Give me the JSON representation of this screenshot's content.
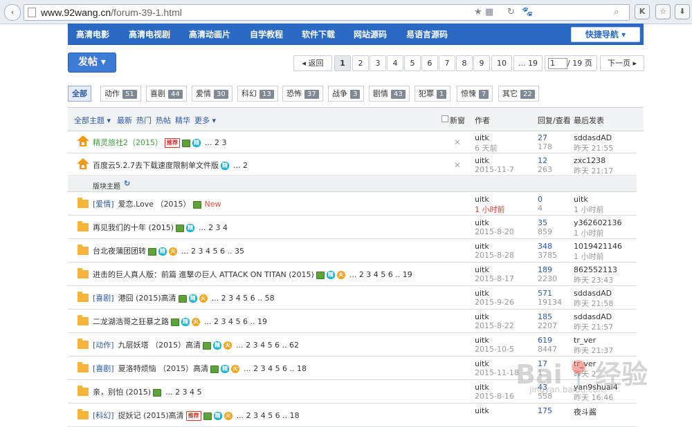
{
  "browser": {
    "url_host": "www.92wang.cn",
    "url_path": "/forum-39-1.html",
    "back_glyph": "‹"
  },
  "nav": {
    "items": [
      "高清电影",
      "高清电视剧",
      "高清动画片",
      "自学教程",
      "软件下载",
      "网站源码",
      "易语言源码"
    ],
    "quick_nav": "快捷导航 ▾"
  },
  "post_button": "发帖 ▾",
  "pager": {
    "back": "◂ 返回",
    "pages": [
      "1",
      "2",
      "3",
      "4",
      "5",
      "6",
      "7",
      "8",
      "9",
      "10",
      "... 19"
    ],
    "current": "1",
    "input_value": "1",
    "total": "/ 19 页",
    "next": "下一页 ▸"
  },
  "categories": [
    {
      "label": "全部",
      "count": ""
    },
    {
      "label": "动作",
      "count": "51"
    },
    {
      "label": "喜剧",
      "count": "44"
    },
    {
      "label": "爱情",
      "count": "30"
    },
    {
      "label": "科幻",
      "count": "13"
    },
    {
      "label": "恐怖",
      "count": "37"
    },
    {
      "label": "战争",
      "count": "3"
    },
    {
      "label": "剧情",
      "count": "43"
    },
    {
      "label": "犯罪",
      "count": "1"
    },
    {
      "label": "惊悚",
      "count": "7"
    },
    {
      "label": "其它",
      "count": "22"
    }
  ],
  "table_header": {
    "all_topics": "全部主题 ▾",
    "latest": "最新",
    "hot": "热门",
    "hot_posts": "热帖",
    "digest": "精华",
    "more": "更多 ▾",
    "new_window": "新窗",
    "author": "作者",
    "replies_views": "回复/查看",
    "last_post": "最后发表"
  },
  "section_label": "版块主题",
  "section_refresh": "↻",
  "badges": {
    "recommend": "推荐",
    "digest": "精",
    "hot": "火",
    "new": "New"
  },
  "sticky": [
    {
      "title": "精灵旅社2（2015）",
      "green": true,
      "badges": [
        "recommend",
        "img",
        "digest"
      ],
      "pages": "... 2 3",
      "author": "uitk",
      "date": "6 天前",
      "replies": "27",
      "views": "178",
      "last_user": "sddasdAD",
      "last_time": "昨天 21:55"
    },
    {
      "title": "百度云5.2.7去下载速度限制单文件版",
      "green": false,
      "badges": [
        "digest"
      ],
      "pages": "... 2",
      "author": "uitk",
      "date": "2015-11-7",
      "replies": "12",
      "views": "263",
      "last_user": "zxc1238",
      "last_time": "昨天 21:17"
    }
  ],
  "threads": [
    {
      "tag": "[爱情]",
      "title": "爱恋.Love （2015）",
      "badges": [
        "img",
        "new"
      ],
      "pages": "",
      "author": "uitk",
      "date": "1 小时前",
      "date_red": true,
      "replies": "0",
      "views": "4",
      "last_user": "uitk",
      "last_time": "1 小时前"
    },
    {
      "tag": "",
      "title": "再见我们的十年 (2015)",
      "badges": [
        "img",
        "digest"
      ],
      "pages": "... 2 3 4",
      "author": "uitk",
      "date": "2015-8-20",
      "date_red": false,
      "replies": "35",
      "views": "859",
      "last_user": "y362602136",
      "last_time": "1 小时前"
    },
    {
      "tag": "",
      "title": "台北夜蒲团团转",
      "badges": [
        "img",
        "digest",
        "hot"
      ],
      "pages": "... 2 3 4 5 6 .. 35",
      "author": "uitk",
      "date": "2015-8-28",
      "date_red": false,
      "replies": "348",
      "views": "3785",
      "last_user": "1019421146",
      "last_time": "1 小时前"
    },
    {
      "tag": "",
      "title": "进击的巨人真人版：前篇 進撃の巨人 ATTACK ON TITAN (2015)",
      "badges": [
        "img",
        "digest",
        "hot"
      ],
      "pages": "... 2 3 4 5 6 .. 19",
      "author": "uitk",
      "date": "2015-8-17",
      "date_red": false,
      "replies": "189",
      "views": "2230",
      "last_user": "862552113",
      "last_time": "昨天 23:43"
    },
    {
      "tag": "[喜剧]",
      "title": "港囧 (2015)高清",
      "badges": [
        "img",
        "digest",
        "hot"
      ],
      "pages": "... 2 3 4 5 6 .. 58",
      "author": "uitk",
      "date": "2015-9-26",
      "date_red": false,
      "replies": "571",
      "views": "19134",
      "last_user": "sddasdAD",
      "last_time": "昨天 21:58"
    },
    {
      "tag": "",
      "title": "二龙湖浩哥之狂暴之路",
      "badges": [
        "img",
        "digest",
        "hot"
      ],
      "pages": "... 2 3 4 5 6 .. 19",
      "author": "uitk",
      "date": "2015-8-22",
      "date_red": false,
      "replies": "185",
      "views": "2207",
      "last_user": "sddasdAD",
      "last_time": "昨天 21:57"
    },
    {
      "tag": "[动作]",
      "title": "九层妖塔 （2015）高清",
      "badges": [
        "img",
        "digest",
        "hot"
      ],
      "pages": "... 2 3 4 5 6 .. 62",
      "author": "uitk",
      "date": "2015-10-5",
      "date_red": false,
      "replies": "619",
      "views": "8447",
      "last_user": "tr_ver",
      "last_time": "昨天 21:37"
    },
    {
      "tag": "[喜剧]",
      "title": "夏洛特烦恼 （2015）高清",
      "badges": [
        "img",
        "digest",
        "hot"
      ],
      "pages": "... 2 3 4 5 6 .. 18",
      "author": "uitk",
      "date": "2015-11-18",
      "date_red": false,
      "replies": "17",
      "views": "1",
      "last_user": "tr_ver",
      "last_time": "昨天 2"
    },
    {
      "tag": "",
      "title": "亲，别怕 (2015)",
      "badges": [
        "img"
      ],
      "pages": "... 2 3 4 5",
      "author": "uitk",
      "date": "2015-8-16",
      "date_red": false,
      "replies": "43",
      "views": "558",
      "last_user": "yan9shuai4",
      "last_time": "昨天 16:46"
    },
    {
      "tag": "[科幻]",
      "title": "捉妖记 (2015)高清",
      "badges": [
        "recommend",
        "img",
        "digest",
        "hot"
      ],
      "pages": "... 2 3 4 5 6 .. 18",
      "author": "uitk",
      "date": "",
      "date_red": false,
      "replies": "175",
      "views": "",
      "last_user": "夜斗酱",
      "last_time": ""
    }
  ],
  "watermark": {
    "main": "Bai📍经验",
    "sub": "jingyan.baidu.com"
  },
  "colors": {
    "nav_blue": "#2a6ac4",
    "link_blue": "#2a5aa6",
    "digest_cyan": "#1db4d1",
    "hot_orange": "#f5a21a",
    "folder_yellow": "#f7b43a",
    "new_red": "#e14c3c"
  }
}
